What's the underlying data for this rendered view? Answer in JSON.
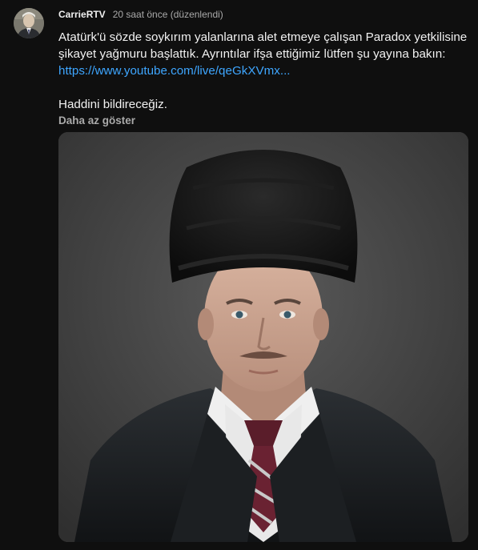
{
  "post": {
    "author": "CarrieRTV",
    "timestamp": "20 saat önce (düzenlendi)",
    "text_part1": "Atatürk'ü sözde soykırım yalanlarına alet etmeye çalışan Paradox yetkilisine şikayet yağmuru başlattık. Ayrıntılar ifşa ettiğimiz lütfen şu yayına bakın: ",
    "link_text": "https://www.youtube.com/live/qeGkXVmx...",
    "text_part2": "Haddini bildireceğiz.",
    "show_less": "Daha az göster",
    "avatar_icon": "user-avatar",
    "image_icon": "portrait-photo"
  },
  "colors": {
    "background": "#0f0f0f",
    "text": "#f1f1f1",
    "muted": "#aaaaaa",
    "link": "#3ea6ff"
  }
}
